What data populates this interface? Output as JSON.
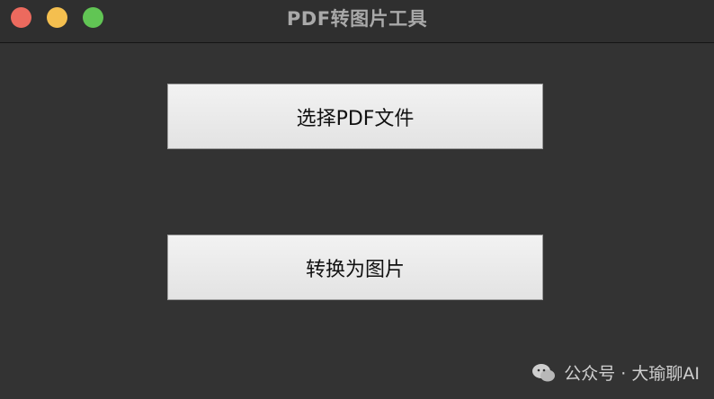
{
  "window": {
    "title": "PDF转图片工具"
  },
  "buttons": {
    "choose_pdf": "选择PDF文件",
    "convert": "转换为图片"
  },
  "watermark": {
    "text": "公众号 · 大瑜聊AI",
    "icon": "wechat-icon"
  },
  "colors": {
    "close": "#ec6a5e",
    "minimize": "#f4bf4f",
    "maximize": "#61c554"
  }
}
